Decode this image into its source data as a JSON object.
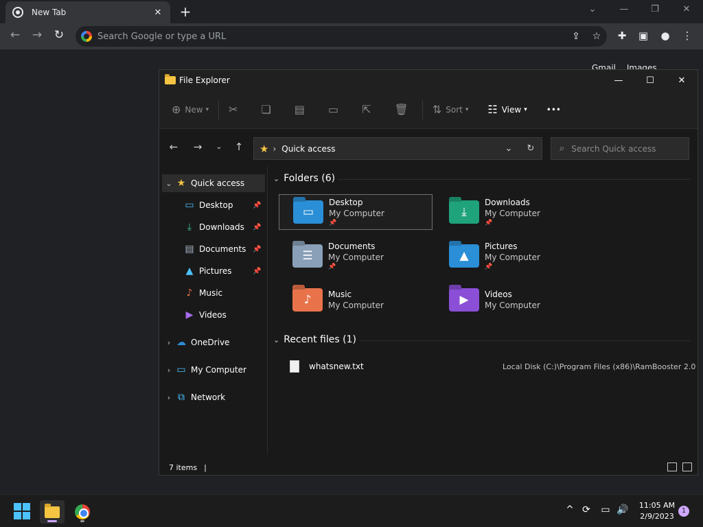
{
  "chrome": {
    "tab_title": "New Tab",
    "tab_close": "✕",
    "new_tab": "+",
    "omnibox_placeholder": "Search Google or type a URL",
    "ntp_links": [
      "Gmail",
      "Images"
    ]
  },
  "explorer": {
    "title": "File Explorer",
    "commands": {
      "new_label": "New",
      "sort_label": "Sort",
      "view_label": "View",
      "more": "•••"
    },
    "address": {
      "crumb": "Quick access"
    },
    "search_placeholder": "Search Quick access",
    "nav": {
      "quick_access": "Quick access",
      "desktop": "Desktop",
      "downloads": "Downloads",
      "documents": "Documents",
      "pictures": "Pictures",
      "music": "Music",
      "videos": "Videos",
      "onedrive": "OneDrive",
      "my_computer": "My Computer",
      "network": "Network"
    },
    "folders_header": "Folders (6)",
    "folders": [
      {
        "name": "Desktop",
        "location": "My Computer",
        "pinned": "📌",
        "color": "#2a8fd6"
      },
      {
        "name": "Downloads",
        "location": "My Computer",
        "pinned": "📌",
        "color": "#1fa37a"
      },
      {
        "name": "Documents",
        "location": "My Computer",
        "pinned": "📌",
        "color": "#8aa0b8"
      },
      {
        "name": "Pictures",
        "location": "My Computer",
        "pinned": "📌",
        "color": "#2a8fd6"
      },
      {
        "name": "Music",
        "location": "My Computer",
        "color": "#e8734a"
      },
      {
        "name": "Videos",
        "location": "My Computer",
        "color": "#8a4fd6"
      }
    ],
    "recent_header": "Recent files (1)",
    "recent": [
      {
        "name": "whatsnew.txt",
        "path": "Local Disk (C:)\\Program Files (x86)\\RamBooster 2.0"
      }
    ],
    "status_items": "7 items",
    "status_cursor": "|"
  },
  "taskbar": {
    "time": "11:05 AM",
    "date": "2/9/2023",
    "notification_count": "1"
  },
  "colors": {
    "accent": "#4cc2ff",
    "folder": "#f5c542",
    "star": "#f5c542"
  }
}
